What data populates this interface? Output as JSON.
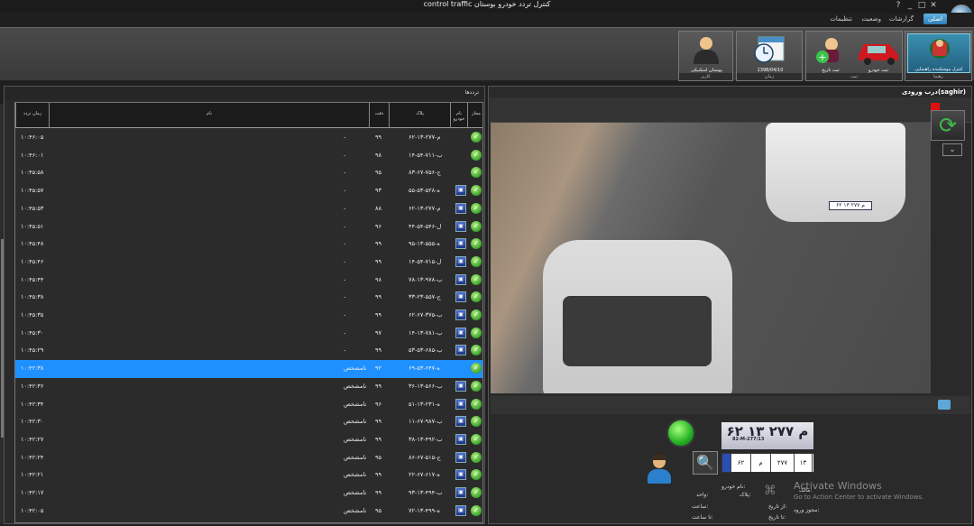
{
  "window": {
    "title": "control traffic  کنترل تردد خودرو بوستان",
    "controls": [
      "_",
      "□",
      "✕",
      "?"
    ]
  },
  "menu": {
    "items": [
      {
        "label": "اصلی",
        "active": true
      },
      {
        "label": "گزارشات",
        "active": false
      },
      {
        "label": "وضعیت",
        "active": false
      },
      {
        "label": "تنظیمات",
        "active": false
      }
    ]
  },
  "ribbon": {
    "groups": {
      "control": {
        "caption": "رهنما",
        "button": "کنترل موشکننده راهنمایی"
      },
      "register": {
        "caption": "ثبت",
        "buttons": [
          "ثبت تاریخ",
          "ثبت خودرو"
        ]
      },
      "time": {
        "caption": "زمان",
        "button": "1398/04/10"
      },
      "users": {
        "caption": "کاربر",
        "button": "پوستان اسکنیکی"
      }
    }
  },
  "left_panel": {
    "caption": "ترددها",
    "columns": {
      "status": "مجاز",
      "type": "نام خودرو",
      "plate": "پلاک",
      "percent": "دقت",
      "name": "نام",
      "time": "زمان تردد"
    },
    "rows": [
      {
        "plate": "۶۲-م-۲۷۷-۱۳",
        "pct": "۹۹",
        "name": "-",
        "time": "۱۰:۴۶:۰۵",
        "icon": false
      },
      {
        "plate": "۱۴-ب-۷۱۱-۵۴",
        "pct": "۹۸",
        "name": "-",
        "time": "۱۰:۴۶:۰۱",
        "icon": false
      },
      {
        "plate": "۸۳-ج-۷۵۶-۶۷",
        "pct": "۹۵",
        "name": "-",
        "time": "۱۰:۴۵:۵۸",
        "icon": false
      },
      {
        "plate": "۵۵-ه-۵۲۸-۵۳",
        "pct": "۹۳",
        "name": "-",
        "time": "۱۰:۴۵:۵۷",
        "icon": true
      },
      {
        "plate": "۶۲-م-۲۷۷-۱۳",
        "pct": "۸۸",
        "name": "-",
        "time": "۱۰:۴۵:۵۳",
        "icon": true
      },
      {
        "plate": "۴۴-ل-۵۴۶-۵۴",
        "pct": "۹۶",
        "name": "-",
        "time": "۱۰:۴۵:۵۱",
        "icon": true
      },
      {
        "plate": "۹۵-ه-۵۵۵-۱۳",
        "pct": "۹۹",
        "name": "-",
        "time": "۱۰:۴۵:۴۸",
        "icon": true
      },
      {
        "plate": "۱۴-ل-۷۱۵-۵۴",
        "pct": "۹۹",
        "name": "-",
        "time": "۱۰:۴۵:۴۶",
        "icon": true
      },
      {
        "plate": "۷۸-ب-۹۷۸-۱۳",
        "pct": "۹۸",
        "name": "-",
        "time": "۱۰:۴۵:۴۴",
        "icon": true
      },
      {
        "plate": "۳۳-ج-۵۵۷-۲۳",
        "pct": "۹۹",
        "name": "-",
        "time": "۱۰:۴۵:۳۸",
        "icon": true
      },
      {
        "plate": "۶۲-ب-۳۷۵-۶۷",
        "pct": "۹۹",
        "name": "-",
        "time": "۱۰:۴۵:۳۵",
        "icon": true
      },
      {
        "plate": "۱۴-ب-۷۸۱-۱۳",
        "pct": "۹۷",
        "name": "-",
        "time": "۱۰:۴۵:۳۰",
        "icon": true
      },
      {
        "plate": "۵۳-ب-۶۸۵-۵۳",
        "pct": "۹۹",
        "name": "-",
        "time": "۱۰:۴۵:۲۹",
        "icon": true
      },
      {
        "plate": "۶۹-ه-۶۴۷-۵۳",
        "pct": "۹۲",
        "name": "نامشخص",
        "time": "۱۰:۴۲:۳۸",
        "icon": false,
        "selected": true
      },
      {
        "plate": "۳۶-ب-۵۶۶-۱۳",
        "pct": "۹۹",
        "name": "نامشخص",
        "time": "۱۰:۴۲:۳۶",
        "icon": true
      },
      {
        "plate": "۵۱-ه-۲۳۱-۱۳",
        "pct": "۹۶",
        "name": "نامشخص",
        "time": "۱۰:۴۲:۳۴",
        "icon": true
      },
      {
        "plate": "۱۱-ب-۹۸۷-۶۷",
        "pct": "۹۹",
        "name": "نامشخص",
        "time": "۱۰:۴۲:۳۰",
        "icon": true
      },
      {
        "plate": "۳۸-ب-۴۹۲-۱۳",
        "pct": "۹۹",
        "name": "نامشخص",
        "time": "۱۰:۴۲:۲۷",
        "icon": true
      },
      {
        "plate": "۸۶-ج-۵۱۵-۶۷",
        "pct": "۹۵",
        "name": "نامشخص",
        "time": "۱۰:۴۲:۲۴",
        "icon": true
      },
      {
        "plate": "۲۲-ه-۶۱۷-۶۷",
        "pct": "۹۹",
        "name": "نامشخص",
        "time": "۱۰:۴۲:۲۱",
        "icon": true
      },
      {
        "plate": "۹۳-ب-۴۹۴-۱۳",
        "pct": "۹۹",
        "name": "نامشخص",
        "time": "۱۰:۴۲:۱۷",
        "icon": true
      },
      {
        "plate": "۷۲-ه-۴۹۹-۱۳",
        "pct": "۹۵",
        "name": "نامشخص",
        "time": "۱۰:۴۲:۰۵",
        "icon": true
      }
    ]
  },
  "right_panel": {
    "caption": "درب ورودی(saghir)",
    "plate_reading": "۶۲ م ۲۷۷ ۱۳",
    "plate_small": "82-M-277/13",
    "plate_cells": [
      "۱۳",
      "۲۷۷",
      "م",
      "۶۲"
    ],
    "info": {
      "car_name_label": "نام خودرو:",
      "vehicle_label": "واحد:",
      "plate_label": "پلاک:",
      "time_label": "ساعت:",
      "from_date_label": "از تاریخ:",
      "to_date_label": "تا تاریخ:",
      "permit_label": "مجوز ورود:",
      "hour_label": "تا ساعت:",
      "owner_label": "مالک:"
    }
  },
  "watermark": {
    "line1": "Activate Windows",
    "line2": "Go to Action Center to activate Windows."
  }
}
